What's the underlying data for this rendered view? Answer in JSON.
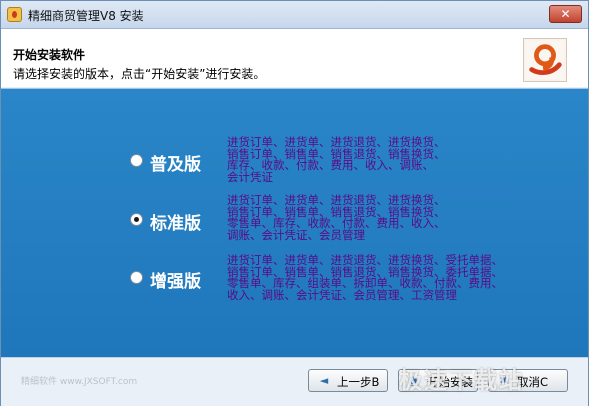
{
  "window": {
    "title": "精细商贸管理V8 安装",
    "close_label": "✕"
  },
  "header": {
    "title": "开始安装软件",
    "subtitle": "请选择安装的版本，点击“开始安装”进行安装。"
  },
  "editions": [
    {
      "label": "普及版",
      "selected": false,
      "features": [
        "进货订单、进货单、进货退货、进货换货、",
        "销售订单、销售单、销售退货、销售换货、",
        "库存、收款、付款、费用、收入、调账、",
        "会计凭证"
      ]
    },
    {
      "label": "标准版",
      "selected": true,
      "features": [
        "进货订单、进货单、进货退货、进货换货、",
        "销售订单、销售单、销售退货、销售换货、",
        "零售单、库存、收款、付款、费用、收入、",
        "调账、会计凭证、会员管理"
      ]
    },
    {
      "label": "增强版",
      "selected": false,
      "features": [
        "进货订单、进货单、进货退货、进货换货、受托单据、",
        "销售订单、销售单、销售退货、销售换货、委托单据、",
        "零售单、库存、组装单、拆卸单、收款、付款、费用、",
        "收入、调账、会计凭证、会员管理、工资管理"
      ]
    }
  ],
  "footer": {
    "note": "精细软件 www.JXSOFT.com",
    "back_label": "上一步B",
    "next_label": "开始安装",
    "cancel_label": "取消C"
  },
  "watermark": "极速下载站",
  "colors": {
    "main_bg": "#2a86c8",
    "feature_text": "#5a0a88",
    "edition_text": "#ffffff"
  },
  "icons": {
    "back": "arrow-left-icon",
    "next": "install-icon",
    "cancel": "cancel-icon"
  }
}
